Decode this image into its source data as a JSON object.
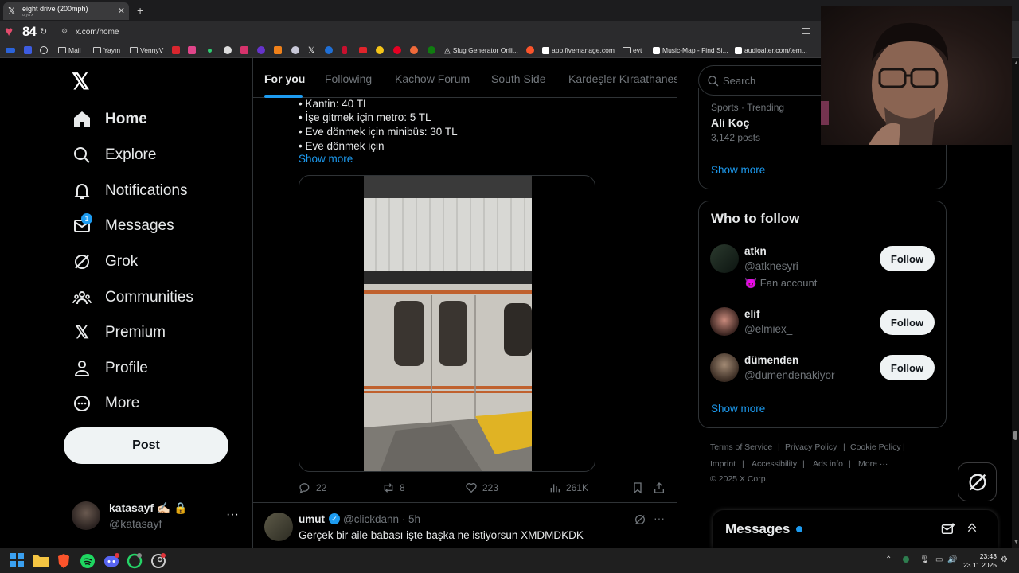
{
  "browser": {
    "tab_title": "eight drive (200mph)",
    "tab_subtitle": "urya x",
    "new_tab": "+",
    "heart_rate": "84",
    "url": "x.com/home",
    "bookmarks": [
      {
        "label": "Mail",
        "icon": "folder-icon"
      },
      {
        "label": "Yayın",
        "icon": "folder-icon"
      },
      {
        "label": "VennyV",
        "icon": "folder-icon"
      },
      {
        "label": "Slug Generator Onli...",
        "icon": "slug-icon"
      },
      {
        "label": "app.fivemanage.com",
        "icon": "brave-icon"
      },
      {
        "label": "evt",
        "icon": "folder-icon"
      },
      {
        "label": "Music-Map - Find Si...",
        "icon": "music-map-icon"
      },
      {
        "label": "audioalter.com/tem...",
        "icon": "audioalter-icon"
      }
    ]
  },
  "nav": {
    "items": [
      {
        "label": "Home",
        "icon": "home-icon"
      },
      {
        "label": "Explore",
        "icon": "search-icon"
      },
      {
        "label": "Notifications",
        "icon": "bell-icon"
      },
      {
        "label": "Messages",
        "icon": "mail-icon"
      },
      {
        "label": "Grok",
        "icon": "grok-icon"
      },
      {
        "label": "Communities",
        "icon": "communities-icon"
      },
      {
        "label": "Premium",
        "icon": "x-icon"
      },
      {
        "label": "Profile",
        "icon": "profile-icon"
      },
      {
        "label": "More",
        "icon": "more-circle-icon"
      }
    ],
    "messages_badge": "1",
    "post_label": "Post",
    "account_name": "katasayf ✍🏻 🔒",
    "account_handle": "@katasayf",
    "account_more": "···"
  },
  "feed": {
    "tabs": [
      "For you",
      "Following",
      "Kachow Forum",
      "South Side",
      "Kardeşler Kıraathanes"
    ],
    "post_lines": [
      "• Kantin: 40 TL",
      "• İşe gitmek için metro: 5 TL",
      "• Eve dönmek için minibüs: 30 TL",
      "• Eve dönmek için"
    ],
    "show_more": "Show more",
    "actions": {
      "replies": "22",
      "reposts": "8",
      "likes": "223",
      "views": "261K"
    },
    "next_post": {
      "name": "umut",
      "handle": "@clickdann · 5h",
      "text": "Gerçek bir aile babası işte başka ne istiyorsun XMDMDKDK",
      "more": "···"
    }
  },
  "sidebar": {
    "search_placeholder": "Search",
    "trend": {
      "category": "Sports · Trending",
      "name": "Ali Koç",
      "posts": "3,142 posts",
      "show_more": "Show more"
    },
    "who_to_follow": {
      "title": "Who to follow",
      "users": [
        {
          "name": "atkn",
          "handle": "@atknesyri",
          "extra": "😈 Fan account",
          "button": "Follow"
        },
        {
          "name": "elif",
          "handle": "@elmiex_",
          "extra": "",
          "button": "Follow"
        },
        {
          "name": "dümenden",
          "handle": "@dumendenakiyor",
          "extra": "",
          "button": "Follow"
        }
      ],
      "show_more": "Show more"
    },
    "footer": {
      "terms": "Terms of Service",
      "privacy": "Privacy Policy",
      "cookie": "Cookie Policy",
      "imprint": "Imprint",
      "accessibility": "Accessibility",
      "ads": "Ads info",
      "more": "More ···",
      "copyright": "© 2025 X Corp."
    }
  },
  "messages_drawer": {
    "title": "Messages"
  },
  "taskbar": {
    "time": "23:43",
    "date": "23.11.2025"
  }
}
